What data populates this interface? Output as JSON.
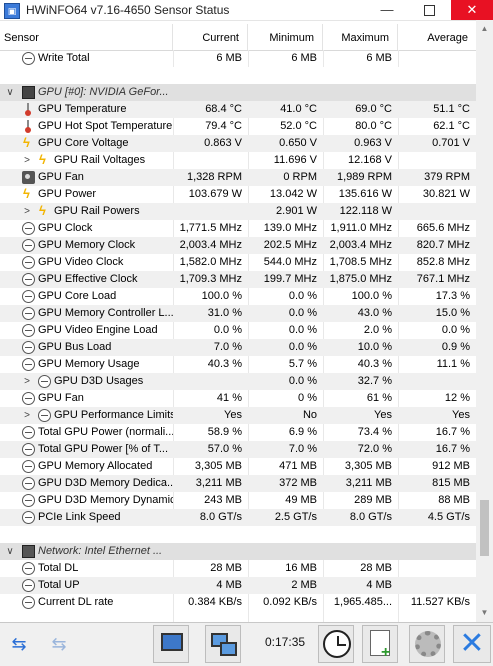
{
  "window": {
    "title": "HWiNFO64 v7.16-4650 Sensor Status",
    "minimize": "—",
    "close": "✕"
  },
  "columns": {
    "sensor": "Sensor",
    "current": "Current",
    "minimum": "Minimum",
    "maximum": "Maximum",
    "average": "Average"
  },
  "rows": [
    {
      "label": "Write Total",
      "icon": "clock-icon",
      "indent": 1,
      "cur": "6 MB",
      "min": "6 MB",
      "max": "6 MB",
      "avg": ""
    },
    {
      "label": "",
      "blank": true
    },
    {
      "label": "GPU [#0]: NVIDIA GeFor...",
      "icon": "chip-icon",
      "group": true,
      "expander": "∨"
    },
    {
      "label": "GPU Temperature",
      "icon": "thermometer-icon",
      "indent": 1,
      "cur": "68.4 °C",
      "min": "41.0 °C",
      "max": "69.0 °C",
      "avg": "51.1 °C"
    },
    {
      "label": "GPU Hot Spot Temperature",
      "icon": "thermometer-icon",
      "indent": 1,
      "cur": "79.4 °C",
      "min": "52.0 °C",
      "max": "80.0 °C",
      "avg": "62.1 °C"
    },
    {
      "label": "GPU Core Voltage",
      "icon": "bolt-icon",
      "indent": 1,
      "cur": "0.863 V",
      "min": "0.650 V",
      "max": "0.963 V",
      "avg": "0.701 V"
    },
    {
      "label": "GPU Rail Voltages",
      "icon": "bolt-icon",
      "indent": 2,
      "expander": ">",
      "cur": "",
      "min": "11.696 V",
      "max": "12.168 V",
      "avg": ""
    },
    {
      "label": "GPU Fan",
      "icon": "fan-icon",
      "indent": 1,
      "cur": "1,328 RPM",
      "min": "0 RPM",
      "max": "1,989 RPM",
      "avg": "379 RPM"
    },
    {
      "label": "GPU Power",
      "icon": "bolt-icon",
      "indent": 1,
      "cur": "103.679 W",
      "min": "13.042 W",
      "max": "135.616 W",
      "avg": "30.821 W"
    },
    {
      "label": "GPU Rail Powers",
      "icon": "bolt-icon",
      "indent": 2,
      "expander": ">",
      "cur": "",
      "min": "2.901 W",
      "max": "122.118 W",
      "avg": ""
    },
    {
      "label": "GPU Clock",
      "icon": "clock-icon",
      "indent": 1,
      "cur": "1,771.5 MHz",
      "min": "139.0 MHz",
      "max": "1,911.0 MHz",
      "avg": "665.6 MHz"
    },
    {
      "label": "GPU Memory Clock",
      "icon": "clock-icon",
      "indent": 1,
      "cur": "2,003.4 MHz",
      "min": "202.5 MHz",
      "max": "2,003.4 MHz",
      "avg": "820.7 MHz"
    },
    {
      "label": "GPU Video Clock",
      "icon": "clock-icon",
      "indent": 1,
      "cur": "1,582.0 MHz",
      "min": "544.0 MHz",
      "max": "1,708.5 MHz",
      "avg": "852.8 MHz"
    },
    {
      "label": "GPU Effective Clock",
      "icon": "clock-icon",
      "indent": 1,
      "cur": "1,709.3 MHz",
      "min": "199.7 MHz",
      "max": "1,875.0 MHz",
      "avg": "767.1 MHz"
    },
    {
      "label": "GPU Core Load",
      "icon": "clock-icon",
      "indent": 1,
      "cur": "100.0 %",
      "min": "0.0 %",
      "max": "100.0 %",
      "avg": "17.3 %"
    },
    {
      "label": "GPU Memory Controller L...",
      "icon": "clock-icon",
      "indent": 1,
      "cur": "31.0 %",
      "min": "0.0 %",
      "max": "43.0 %",
      "avg": "15.0 %"
    },
    {
      "label": "GPU Video Engine Load",
      "icon": "clock-icon",
      "indent": 1,
      "cur": "0.0 %",
      "min": "0.0 %",
      "max": "2.0 %",
      "avg": "0.0 %"
    },
    {
      "label": "GPU Bus Load",
      "icon": "clock-icon",
      "indent": 1,
      "cur": "7.0 %",
      "min": "0.0 %",
      "max": "10.0 %",
      "avg": "0.9 %"
    },
    {
      "label": "GPU Memory Usage",
      "icon": "clock-icon",
      "indent": 1,
      "cur": "40.3 %",
      "min": "5.7 %",
      "max": "40.3 %",
      "avg": "11.1 %"
    },
    {
      "label": "GPU D3D Usages",
      "icon": "clock-icon",
      "indent": 2,
      "expander": ">",
      "cur": "",
      "min": "0.0 %",
      "max": "32.7 %",
      "avg": ""
    },
    {
      "label": "GPU Fan",
      "icon": "clock-icon",
      "indent": 1,
      "cur": "41 %",
      "min": "0 %",
      "max": "61 %",
      "avg": "12 %"
    },
    {
      "label": "GPU Performance Limits",
      "icon": "clock-icon",
      "indent": 2,
      "expander": ">",
      "cur": "Yes",
      "min": "No",
      "max": "Yes",
      "avg": "Yes"
    },
    {
      "label": "Total GPU Power (normali...",
      "icon": "clock-icon",
      "indent": 1,
      "cur": "58.9 %",
      "min": "6.9 %",
      "max": "73.4 %",
      "avg": "16.7 %"
    },
    {
      "label": "Total GPU Power [% of T...",
      "icon": "clock-icon",
      "indent": 1,
      "cur": "57.0 %",
      "min": "7.0 %",
      "max": "72.0 %",
      "avg": "16.7 %"
    },
    {
      "label": "GPU Memory Allocated",
      "icon": "clock-icon",
      "indent": 1,
      "cur": "3,305 MB",
      "min": "471 MB",
      "max": "3,305 MB",
      "avg": "912 MB"
    },
    {
      "label": "GPU D3D Memory Dedica...",
      "icon": "clock-icon",
      "indent": 1,
      "cur": "3,211 MB",
      "min": "372 MB",
      "max": "3,211 MB",
      "avg": "815 MB"
    },
    {
      "label": "GPU D3D Memory Dynamic",
      "icon": "clock-icon",
      "indent": 1,
      "cur": "243 MB",
      "min": "49 MB",
      "max": "289 MB",
      "avg": "88 MB"
    },
    {
      "label": "PCIe Link Speed",
      "icon": "clock-icon",
      "indent": 1,
      "cur": "8.0 GT/s",
      "min": "2.5 GT/s",
      "max": "8.0 GT/s",
      "avg": "4.5 GT/s"
    },
    {
      "label": "",
      "blank": true
    },
    {
      "label": "Network: Intel Ethernet ...",
      "icon": "network-icon",
      "group": true,
      "expander": "∨"
    },
    {
      "label": "Total DL",
      "icon": "clock-icon",
      "indent": 1,
      "cur": "28 MB",
      "min": "16 MB",
      "max": "28 MB",
      "avg": ""
    },
    {
      "label": "Total UP",
      "icon": "clock-icon",
      "indent": 1,
      "cur": "4 MB",
      "min": "2 MB",
      "max": "4 MB",
      "avg": ""
    },
    {
      "label": "Current DL rate",
      "icon": "clock-icon",
      "indent": 1,
      "cur": "0.384 KB/s",
      "min": "0.092 KB/s",
      "max": "1,965.485...",
      "avg": "11.527 KB/s"
    }
  ],
  "toolbar": {
    "elapsed_time": "0:17:35",
    "nav_left": "⇆",
    "nav_right": "⇆"
  }
}
